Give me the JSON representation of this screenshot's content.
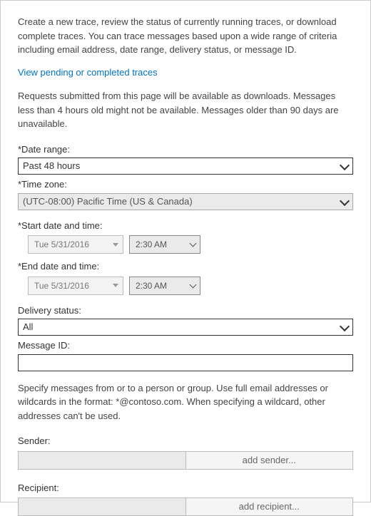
{
  "intro": "Create a new trace, review the status of currently running traces, or download complete traces. You can trace messages based upon a wide range of criteria including email address, date range, delivery status, or message ID.",
  "link_text": "View pending or completed traces",
  "note": "Requests submitted from this page will be available as downloads. Messages less than 4 hours old might not be available. Messages older than 90 days are unavailable.",
  "date_range": {
    "label": "*Date range:",
    "value": "Past 48 hours"
  },
  "time_zone": {
    "label": "*Time zone:",
    "value": "(UTC-08:00) Pacific Time (US & Canada)"
  },
  "start": {
    "label": "*Start date and time:",
    "date": "Tue 5/31/2016",
    "time": "2:30 AM"
  },
  "end": {
    "label": "*End date and time:",
    "date": "Tue 5/31/2016",
    "time": "2:30 AM"
  },
  "delivery_status": {
    "label": "Delivery status:",
    "value": "All"
  },
  "message_id": {
    "label": "Message ID:",
    "value": ""
  },
  "addresses_note": "Specify messages from or to a person or group. Use full email addresses or wildcards in the format: *@contoso.com. When specifying a wildcard, other addresses can't be used.",
  "sender": {
    "label": "Sender:",
    "btn": "add sender..."
  },
  "recipient": {
    "label": "Recipient:",
    "btn": "add recipient..."
  }
}
